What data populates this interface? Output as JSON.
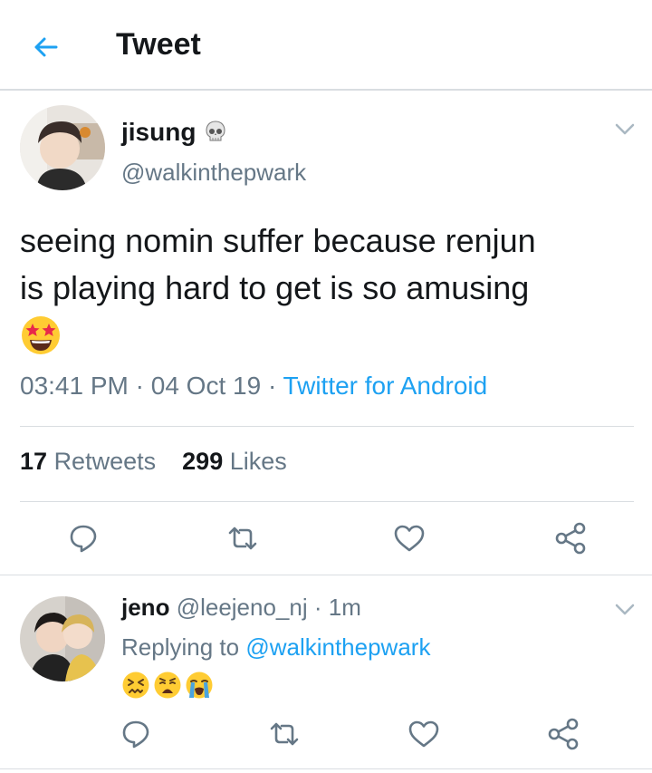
{
  "header": {
    "title": "Tweet",
    "back_icon": "arrow-left-icon",
    "accent": "#1da1f2"
  },
  "tweet": {
    "name": "jisung",
    "name_emoji": "skull-emoji",
    "handle": "@walkinthepwark",
    "text_line1": "seeing nomin suffer because renjun",
    "text_line2": "is playing hard to get is so amusing",
    "text_emoji": "star-struck-emoji",
    "time": "03:41 PM",
    "sep1": "·",
    "date": "04 Oct 19",
    "sep2": "·",
    "source": "Twitter for Android",
    "retweets_count": "17",
    "retweets_label": "Retweets",
    "likes_count": "299",
    "likes_label": "Likes",
    "actions": [
      "reply-icon",
      "retweet-icon",
      "like-icon",
      "share-icon"
    ]
  },
  "reply": {
    "name": "jeno",
    "handle": "@leejeno_nj",
    "sep": "·",
    "time": "1m",
    "replying_label": "Replying to",
    "replying_to": "@walkinthepwark",
    "emojis": [
      "confounded-emoji",
      "weary-emoji",
      "loudly-crying-emoji"
    ],
    "actions": [
      "reply-icon",
      "retweet-icon",
      "like-icon",
      "share-icon"
    ]
  },
  "colors": {
    "text": "#14171a",
    "muted": "#657786",
    "accent": "#1da1f2",
    "divider": "#d9dde1"
  }
}
